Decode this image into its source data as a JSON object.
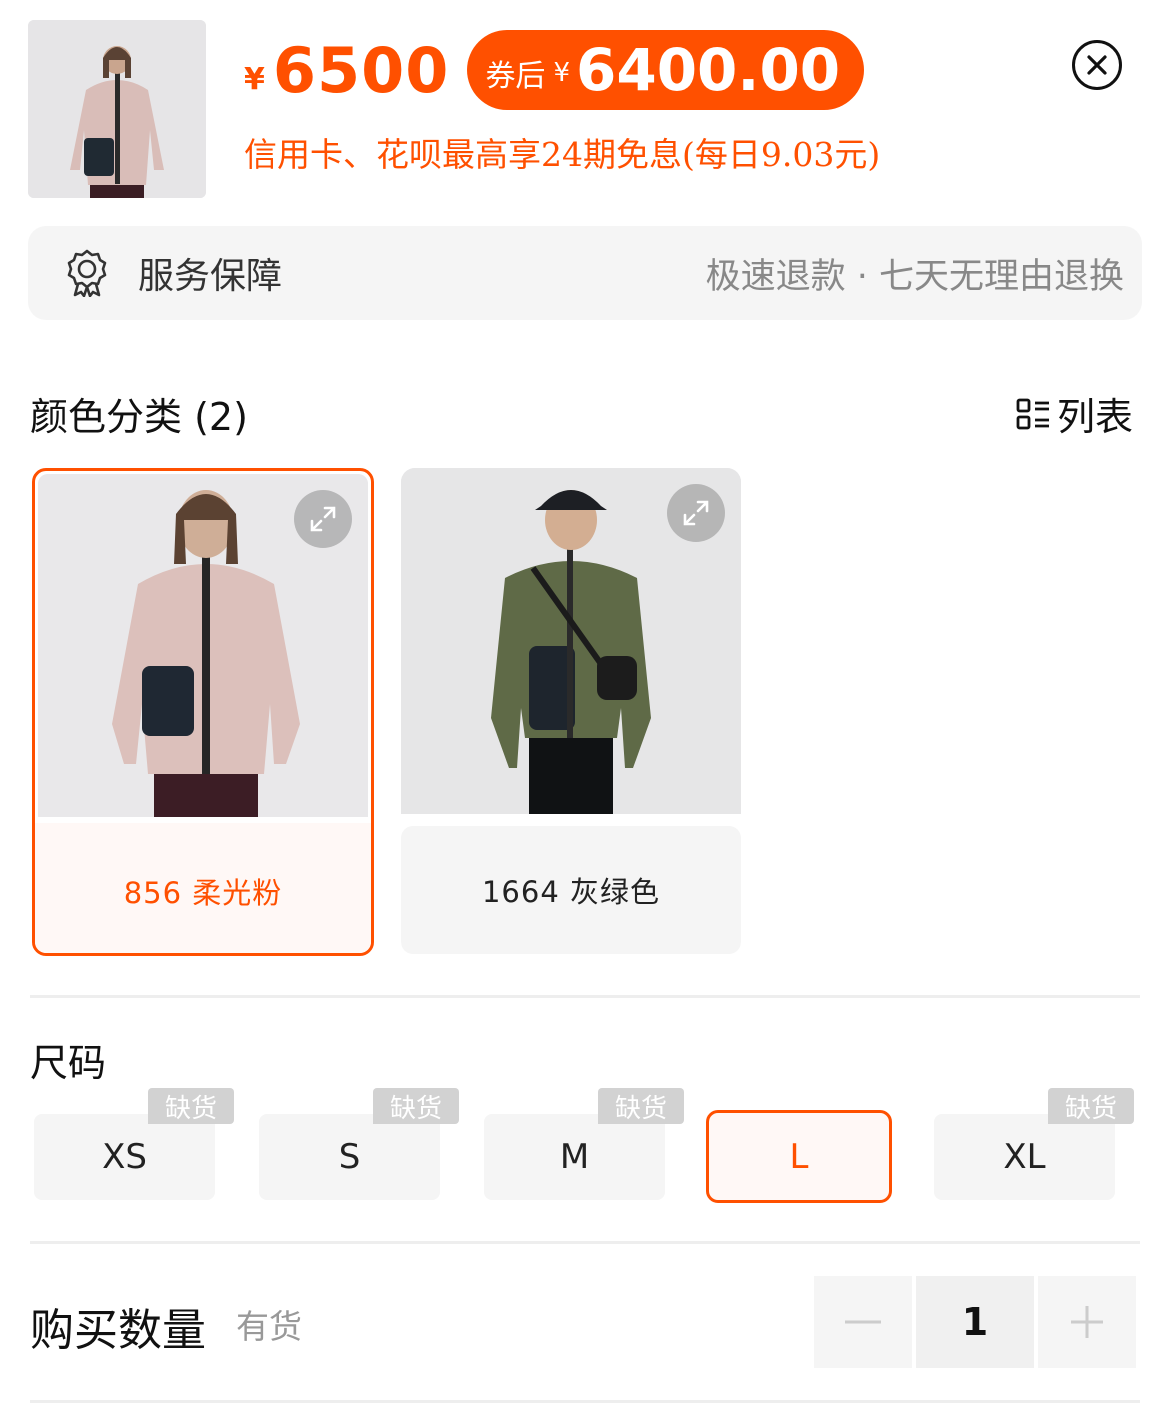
{
  "header": {
    "currency_symbol": "¥",
    "price": "6500",
    "coupon_label": "券后",
    "coupon_currency": "¥",
    "coupon_price": "6400.00",
    "installment_text": "信用卡、花呗最高享24期免息(每日9.03元)",
    "close_icon": "close-circle-icon"
  },
  "service": {
    "icon": "badge-icon",
    "label": "服务保障",
    "value": "极速退款 · 七天无理由退换"
  },
  "color_section": {
    "title": "颜色分类 (2)",
    "list_label": "列表",
    "options": [
      {
        "label": "856 柔光粉",
        "selected": true
      },
      {
        "label": "1664 灰绿色",
        "selected": false
      }
    ]
  },
  "size_section": {
    "title": "尺码",
    "out_of_stock_label": "缺货",
    "options": [
      {
        "label": "XS",
        "out_of_stock": true
      },
      {
        "label": "S",
        "out_of_stock": true
      },
      {
        "label": "M",
        "out_of_stock": true
      },
      {
        "label": "L",
        "out_of_stock": false,
        "selected": true
      },
      {
        "label": "XL",
        "out_of_stock": true
      }
    ]
  },
  "quantity": {
    "label": "购买数量",
    "availability": "有货",
    "value": "1"
  },
  "colors": {
    "accent": "#ff5000",
    "selected_bg": "#fff8f6",
    "chip_bg": "#f5f5f5",
    "muted_text": "#999999"
  }
}
